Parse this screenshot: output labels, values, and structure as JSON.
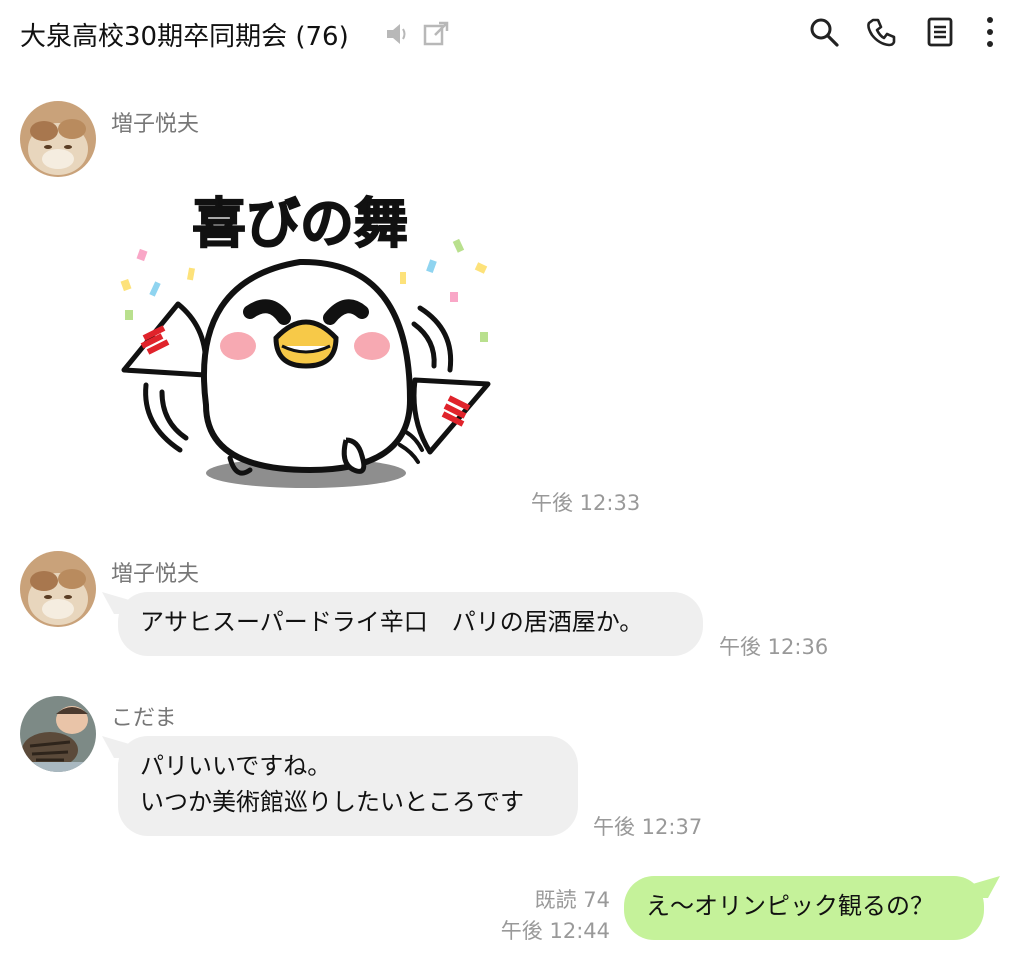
{
  "header": {
    "title": "大泉高校30期卒同期会 (76)",
    "icons": [
      "speaker-muted-icon",
      "external-link-icon",
      "search-icon",
      "phone-icon",
      "notes-icon",
      "more-vert-icon"
    ]
  },
  "messages": [
    {
      "type": "sticker",
      "sender": "増子悦夫",
      "sticker_text": "喜びの舞",
      "time": "午後 12:33"
    },
    {
      "type": "text",
      "sender": "増子悦夫",
      "text": "アサヒスーパードライ辛口　パリの居酒屋か。",
      "time": "午後 12:36"
    },
    {
      "type": "text",
      "sender": "こだま",
      "lines": [
        "パリいいですね。",
        "いつか美術館巡りしたいところです"
      ],
      "time": "午後 12:37"
    },
    {
      "type": "outgoing",
      "read": "既読 74",
      "text": "え〜オリンピック観るの？",
      "time": "午後 12:44"
    }
  ],
  "colors": {
    "incoming_bubble": "#efefef",
    "outgoing_bubble": "#c5f29a",
    "meta_text": "#999999"
  }
}
